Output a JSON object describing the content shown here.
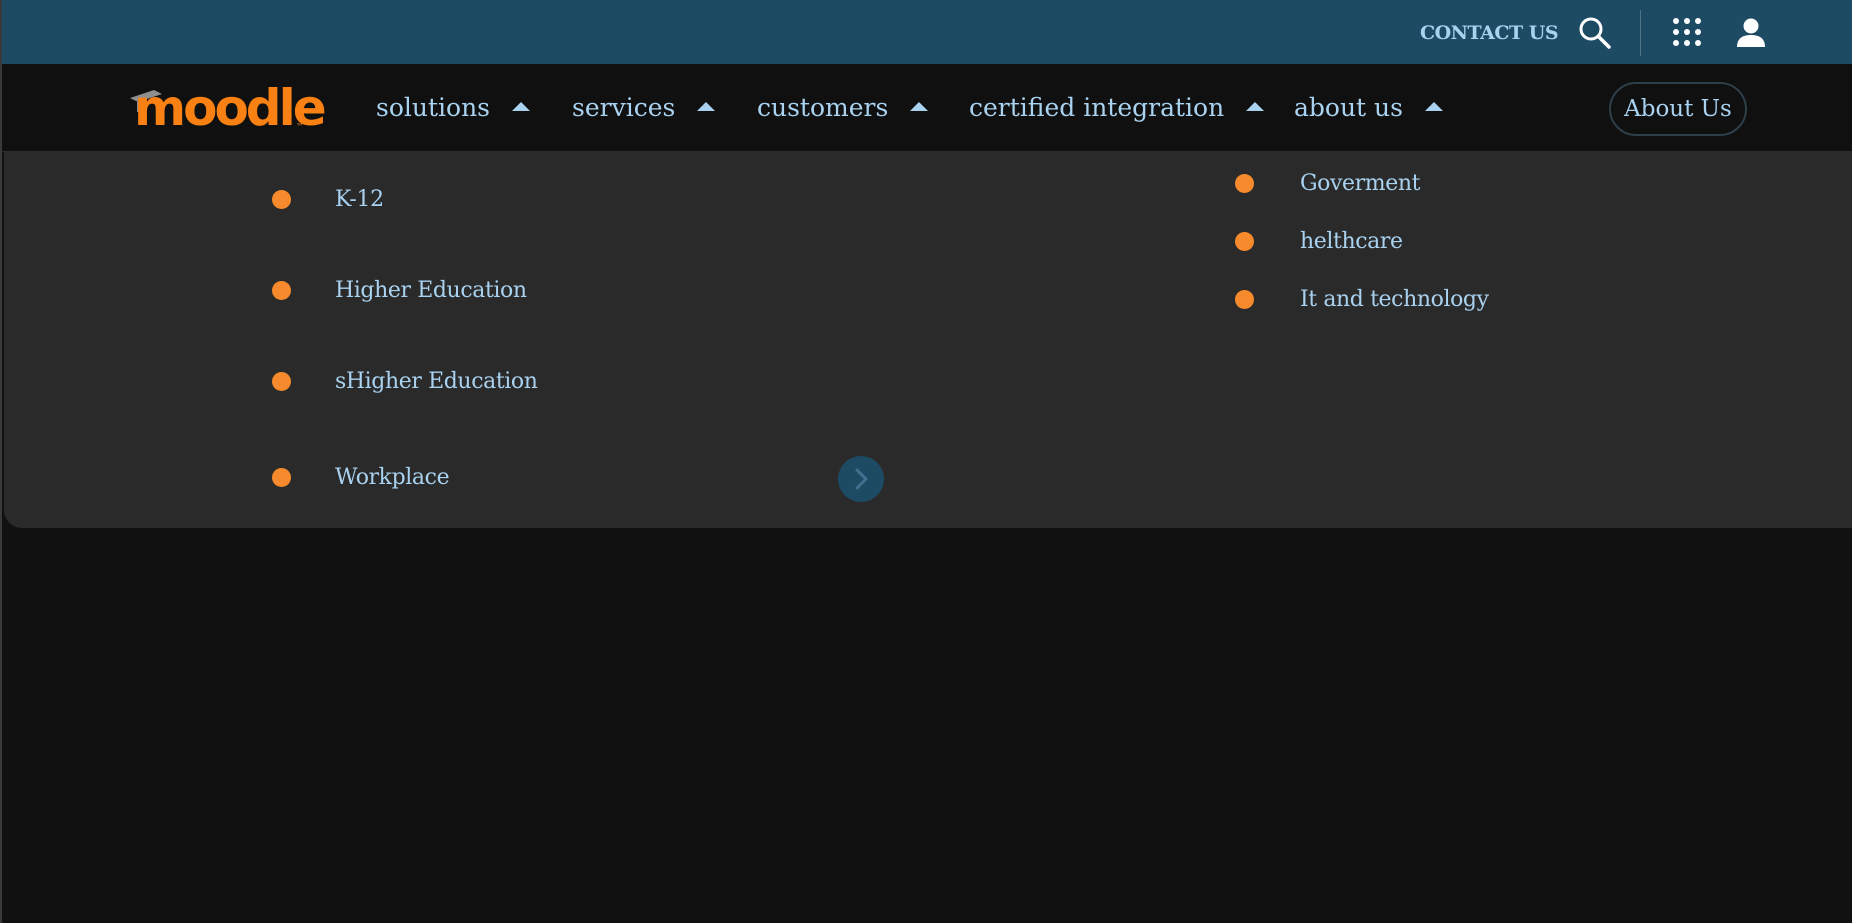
{
  "topbar": {
    "contact_label": "CONTACT US",
    "icons": [
      "search-icon",
      "apps-grid-icon",
      "user-icon"
    ]
  },
  "brand": {
    "logo_text": "moodle",
    "logo_tm": "™",
    "primary_color": "#f98012"
  },
  "nav": {
    "items": [
      {
        "label": "solutions"
      },
      {
        "label": "services"
      },
      {
        "label": "customers"
      },
      {
        "label": "certified integration"
      },
      {
        "label": "about us"
      }
    ],
    "cta_label": "About Us"
  },
  "dropdown": {
    "left_items": [
      {
        "label": "K-12"
      },
      {
        "label": "Higher Education"
      },
      {
        "label": "sHigher Education"
      },
      {
        "label": "Workplace"
      }
    ],
    "right_items": [
      {
        "label": "Goverment"
      },
      {
        "label": "helthcare"
      },
      {
        "label": "It and technology"
      }
    ],
    "next_icon": "chevron-right-icon"
  },
  "colors": {
    "topbar_bg": "#1d4b63",
    "nav_bg": "#101010",
    "panel_bg": "#2a2a2a",
    "link": "#a9d2f0",
    "bullet": "#f78a2c"
  }
}
